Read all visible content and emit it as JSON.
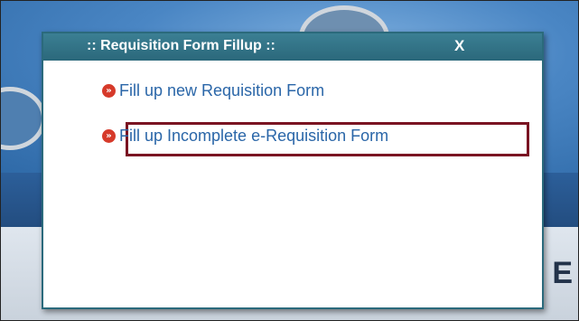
{
  "dialog": {
    "title": ":: Requisition Form Fillup ::",
    "close_label": "X",
    "options": [
      {
        "label": "Fill up new Requisition Form",
        "icon": "double-chevron-right-icon"
      },
      {
        "label": "Fill up Incomplete e-Requisition Form",
        "icon": "double-chevron-right-icon"
      }
    ]
  },
  "background": {
    "partial_text": "E"
  },
  "colors": {
    "header": "#2b687b",
    "link": "#2a66a8",
    "bullet": "#d63a2a",
    "highlight": "#7a1422"
  }
}
